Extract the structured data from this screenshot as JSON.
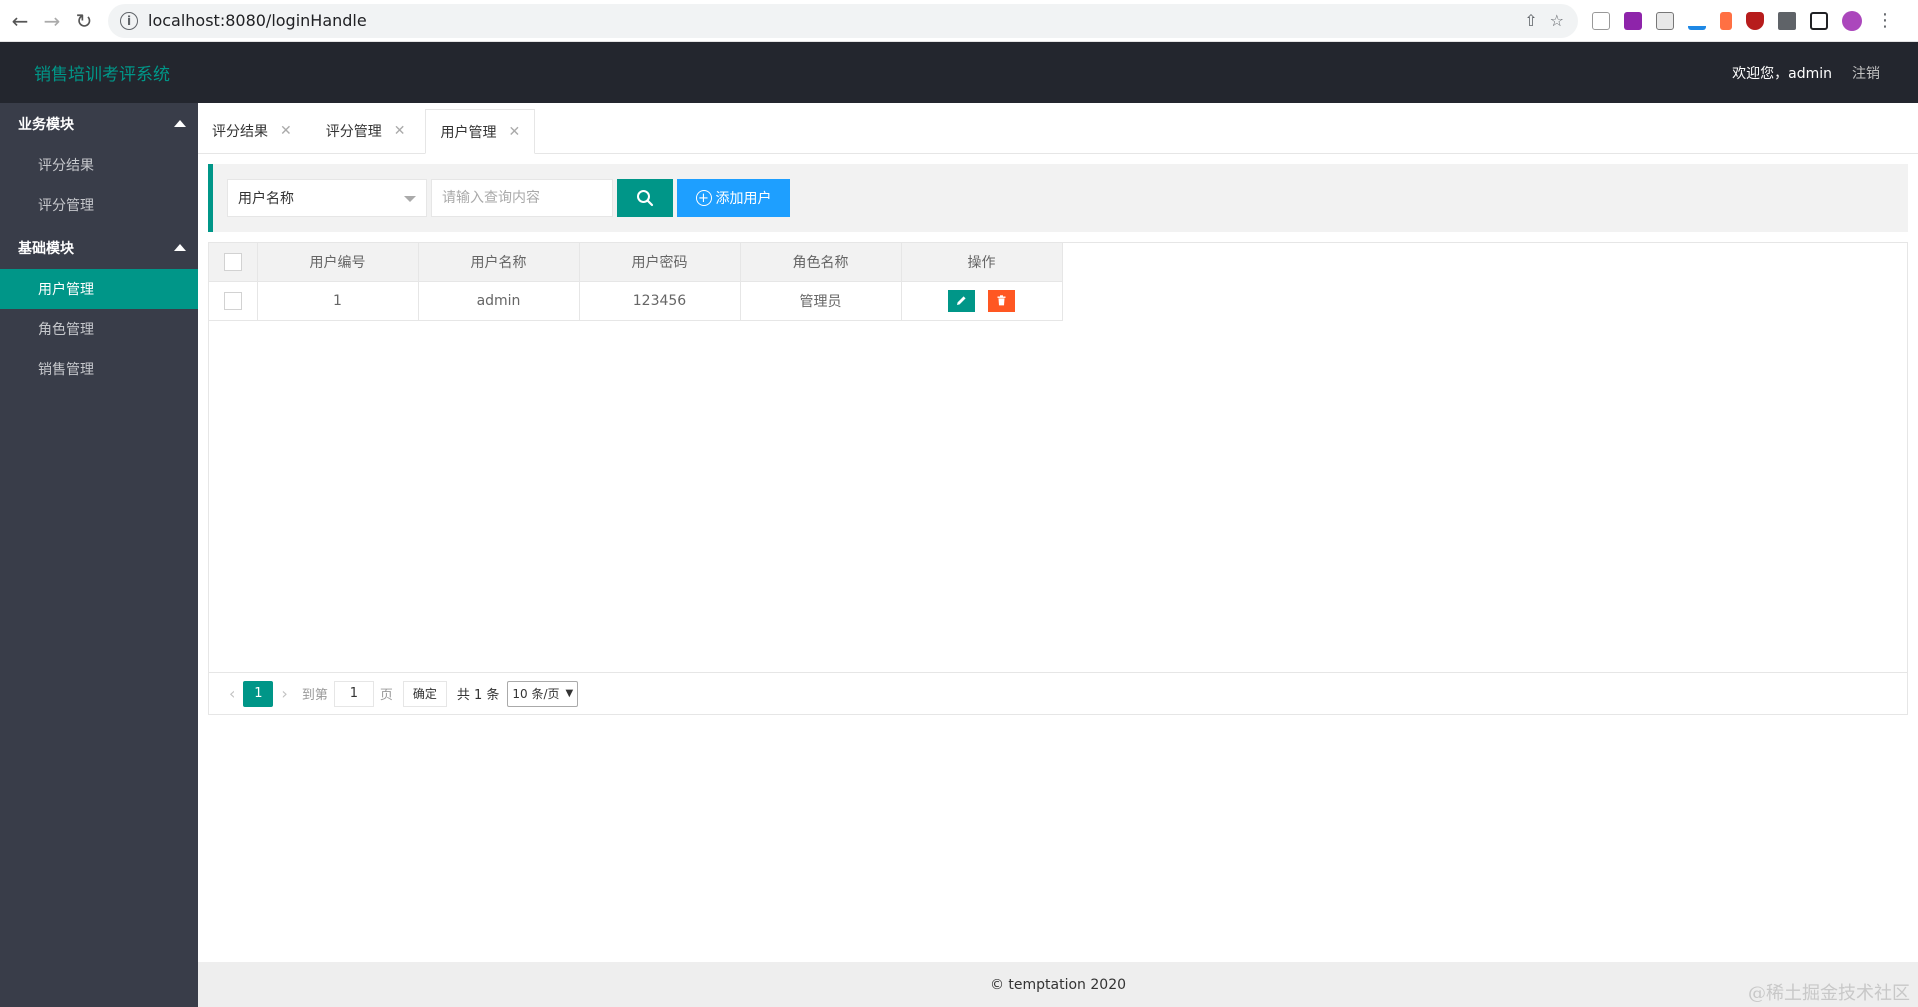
{
  "browser": {
    "url": "localhost:8080/loginHandle"
  },
  "header": {
    "logo": "销售培训考评系统",
    "welcome": "欢迎您，admin",
    "logout": "注销"
  },
  "sidebar": {
    "groups": [
      {
        "label": "业务模块",
        "items": [
          {
            "label": "评分结果"
          },
          {
            "label": "评分管理"
          }
        ]
      },
      {
        "label": "基础模块",
        "items": [
          {
            "label": "用户管理"
          },
          {
            "label": "角色管理"
          },
          {
            "label": "销售管理"
          }
        ]
      }
    ]
  },
  "tabs": [
    {
      "label": "评分结果"
    },
    {
      "label": "评分管理"
    },
    {
      "label": "用户管理"
    }
  ],
  "search": {
    "field_selected": "用户名称",
    "placeholder": "请输入查询内容",
    "add_label": "添加用户"
  },
  "table": {
    "columns": [
      "用户编号",
      "用户名称",
      "用户密码",
      "角色名称",
      "操作"
    ],
    "rows": [
      {
        "id": "1",
        "name": "admin",
        "password": "123456",
        "role": "管理员"
      }
    ]
  },
  "pager": {
    "current": "1",
    "goto_label": "到第",
    "goto_value": "1",
    "page_label": "页",
    "confirm": "确定",
    "total": "共 1 条",
    "page_size": "10 条/页"
  },
  "footer": {
    "copyright": "© temptation 2020"
  },
  "watermark": "@稀土掘金技术社区",
  "colors": {
    "primary": "#009688",
    "header_bg": "#23262e",
    "sidebar_bg": "#393d49",
    "add_button": "#1e9fff",
    "delete_button": "#ff5722"
  }
}
